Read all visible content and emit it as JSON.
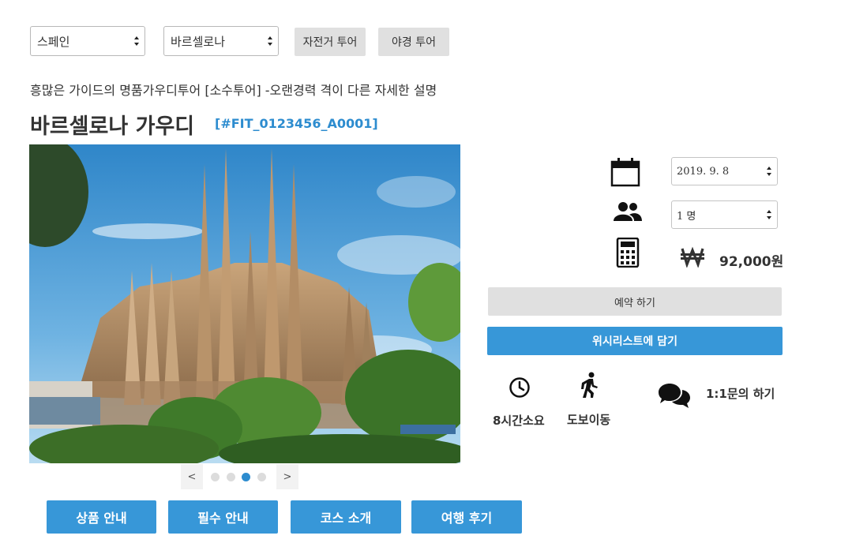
{
  "filters": {
    "country": "스페인",
    "city": "바르셀로나",
    "bike_tour": "자전거 투어",
    "night_tour": "야경 투어"
  },
  "product": {
    "subtitle": "흥많은 가이드의 명품가우디투어 [소수투어] -오랜경력 격이 다른 자세한 설명",
    "title": "바르셀로나 가우디",
    "code": "[#FIT_0123456_A0001]"
  },
  "carousel": {
    "prev": "<",
    "next": ">",
    "count": 4,
    "active_index": 2
  },
  "tabs": [
    "상품 안내",
    "필수 안내",
    "코스 소개",
    "여행 후기"
  ],
  "booking": {
    "date": "2019. 9. 8",
    "people": "1 명",
    "price": "92,000원",
    "reserve": "예약 하기",
    "wishlist": "위시리스트에 담기"
  },
  "info": {
    "duration": "8시간소요",
    "transport": "도보이동",
    "inquiry": "1:1문의 하기"
  },
  "icons": [
    "calendar-icon",
    "people-icon",
    "calculator-icon",
    "won-icon",
    "clock-icon",
    "walking-icon",
    "chat-icon"
  ],
  "colors": {
    "accent": "#3797d8",
    "link": "#2d8ccf",
    "button_gray": "#e0e0e0"
  }
}
